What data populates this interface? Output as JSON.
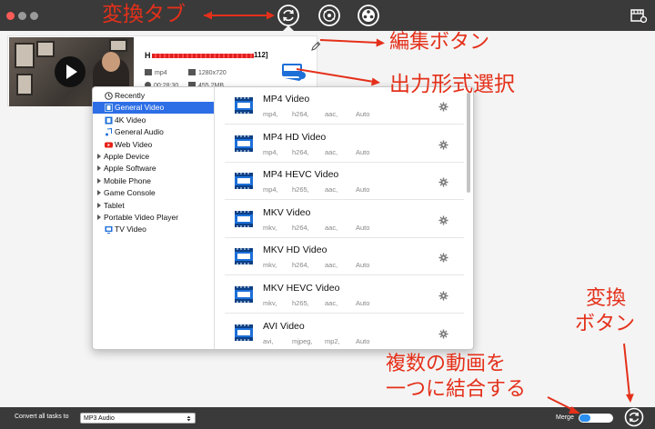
{
  "tabs": [
    {
      "name": "convert",
      "active": true
    },
    {
      "name": "disc"
    },
    {
      "name": "toolbox"
    }
  ],
  "task": {
    "file_name_tail": "112]",
    "file_name_prefix": "H",
    "format": "mp4",
    "resolution": "1280x720",
    "duration": "00:28:30",
    "size": "455.2MB"
  },
  "categories": [
    {
      "label": "Recently",
      "icon": "clock-icon",
      "expandable": false,
      "indent": true
    },
    {
      "label": "General Video",
      "icon": "film-icon",
      "expandable": false,
      "indent": true,
      "selected": true
    },
    {
      "label": "4K Video",
      "icon": "film-4k-icon",
      "expandable": false,
      "indent": true
    },
    {
      "label": "General Audio",
      "icon": "music-note-icon",
      "expandable": false,
      "indent": true
    },
    {
      "label": "Web Video",
      "icon": "youtube-icon",
      "expandable": false,
      "indent": true
    },
    {
      "label": "Apple Device",
      "expandable": true
    },
    {
      "label": "Apple Software",
      "expandable": true
    },
    {
      "label": "Mobile Phone",
      "expandable": true
    },
    {
      "label": "Game Console",
      "expandable": true
    },
    {
      "label": "Tablet",
      "expandable": true
    },
    {
      "label": "Portable Video Player",
      "expandable": true
    },
    {
      "label": "TV Video",
      "icon": "tv-icon",
      "expandable": false,
      "indent": true
    }
  ],
  "formats": [
    {
      "title": "MP4 Video",
      "specs": [
        "mp4,",
        "h264,",
        "aac,",
        "Auto"
      ]
    },
    {
      "title": "MP4 HD Video",
      "specs": [
        "mp4,",
        "h264,",
        "aac,",
        "Auto"
      ]
    },
    {
      "title": "MP4 HEVC Video",
      "specs": [
        "mp4,",
        "h265,",
        "aac,",
        "Auto"
      ]
    },
    {
      "title": "MKV Video",
      "specs": [
        "mkv,",
        "h264,",
        "aac,",
        "Auto"
      ]
    },
    {
      "title": "MKV HD Video",
      "specs": [
        "mkv,",
        "h264,",
        "aac,",
        "Auto"
      ]
    },
    {
      "title": "MKV HEVC Video",
      "specs": [
        "mkv,",
        "h265,",
        "aac,",
        "Auto"
      ]
    },
    {
      "title": "AVI Video",
      "specs": [
        "avi,",
        "mjpeg,",
        "mp2,",
        "Auto"
      ]
    }
  ],
  "bottom": {
    "convert_all_label": "Convert all tasks to",
    "convert_all_value": "MP3 Audio",
    "merge_label": "Merge",
    "merge_on": true
  },
  "annotations": {
    "convert_tab": "変換タブ",
    "edit_button": "編集ボタン",
    "output_format": "出力形式選択",
    "convert_button_line1": "変換",
    "convert_button_line2": "ボタン",
    "merge_line1": "複数の動画を",
    "merge_line2": "一つに結合する"
  },
  "colors": {
    "annotation": "#e4301a",
    "selection": "#2d6ee6",
    "close": "#fc5b57",
    "merge_toggle": "#2a8ff0"
  }
}
